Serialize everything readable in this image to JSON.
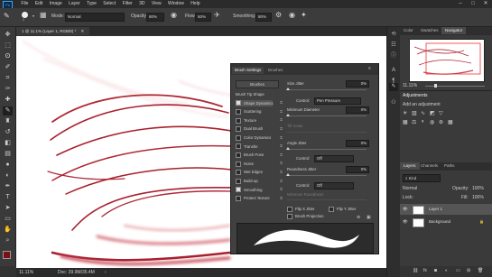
{
  "menu": {
    "logo": "Ps",
    "items": [
      "File",
      "Edit",
      "Image",
      "Layer",
      "Type",
      "Select",
      "Filter",
      "3D",
      "View",
      "Window",
      "Help"
    ],
    "window_controls": [
      "–",
      "□",
      "✕"
    ]
  },
  "options": {
    "brush_size": "1",
    "mode_label": "Mode:",
    "mode_value": "Normal",
    "opacity_label": "Opacity:",
    "opacity_value": "80%",
    "flow_label": "Flow:",
    "flow_value": "50%",
    "smoothing_label": "Smoothing:",
    "smoothing_value": "80%"
  },
  "document": {
    "tab_title": "1 @ 11.1% (Layer 1, RGB/8) *",
    "zoom": "11.11%",
    "doc_size": "Doc: 39.9M/35.4M"
  },
  "brush_panel": {
    "tabs": [
      "Brush Settings",
      "Brushes"
    ],
    "brushes_button": "Brushes",
    "settings": [
      {
        "label": "Brush Tip Shape",
        "checkbox": false,
        "checked": false
      },
      {
        "label": "Shape Dynamics",
        "checkbox": true,
        "checked": true
      },
      {
        "label": "Scattering",
        "checkbox": true,
        "checked": false
      },
      {
        "label": "Texture",
        "checkbox": true,
        "checked": false
      },
      {
        "label": "Dual Brush",
        "checkbox": true,
        "checked": false
      },
      {
        "label": "Color Dynamics",
        "checkbox": true,
        "checked": false
      },
      {
        "label": "Transfer",
        "checkbox": true,
        "checked": false
      },
      {
        "label": "Brush Pose",
        "checkbox": true,
        "checked": false
      },
      {
        "label": "Noise",
        "checkbox": true,
        "checked": false
      },
      {
        "label": "Wet Edges",
        "checkbox": true,
        "checked": false
      },
      {
        "label": "Build-up",
        "checkbox": true,
        "checked": false
      },
      {
        "label": "Smoothing",
        "checkbox": true,
        "checked": true
      },
      {
        "label": "Protect Texture",
        "checkbox": true,
        "checked": false
      }
    ],
    "size_jitter_label": "Size Jitter",
    "size_jitter_value": "0%",
    "control_label": "Control:",
    "size_control": "Pen Pressure",
    "min_diameter_label": "Minimum Diameter",
    "min_diameter_value": "0%",
    "tilt_scale_label": "Tilt Scale",
    "angle_jitter_label": "Angle Jitter",
    "angle_jitter_value": "0%",
    "angle_control": "Off",
    "roundness_jitter_label": "Roundness Jitter",
    "roundness_jitter_value": "0%",
    "roundness_control": "Off",
    "min_roundness_label": "Minimum Roundness",
    "flip_x": "Flip X Jitter",
    "flip_y": "Flip Y Jitter",
    "brush_projection": "Brush Projection"
  },
  "right_panels": {
    "top_tabs": [
      "Color",
      "Swatches",
      "Navigator"
    ],
    "nav_zoom": "11.11%",
    "adjustments_title": "Adjustments",
    "adjustments_subtitle": "Add an adjustment",
    "layer_tabs": [
      "Layers",
      "Channels",
      "Paths"
    ],
    "kind_label": "Kind",
    "blend_mode": "Normal",
    "opacity_label": "Opacity:",
    "opacity_value": "100%",
    "lock_label": "Lock:",
    "fill_label": "Fill:",
    "fill_value": "100%",
    "layers": [
      {
        "name": "Layer 1",
        "selected": true
      },
      {
        "name": "Background",
        "selected": false
      }
    ]
  },
  "colors": {
    "stroke": "#a8202f",
    "foreground": "#7a0f16",
    "background_swatch": "#ffffff",
    "accent": "#31a8ff"
  }
}
